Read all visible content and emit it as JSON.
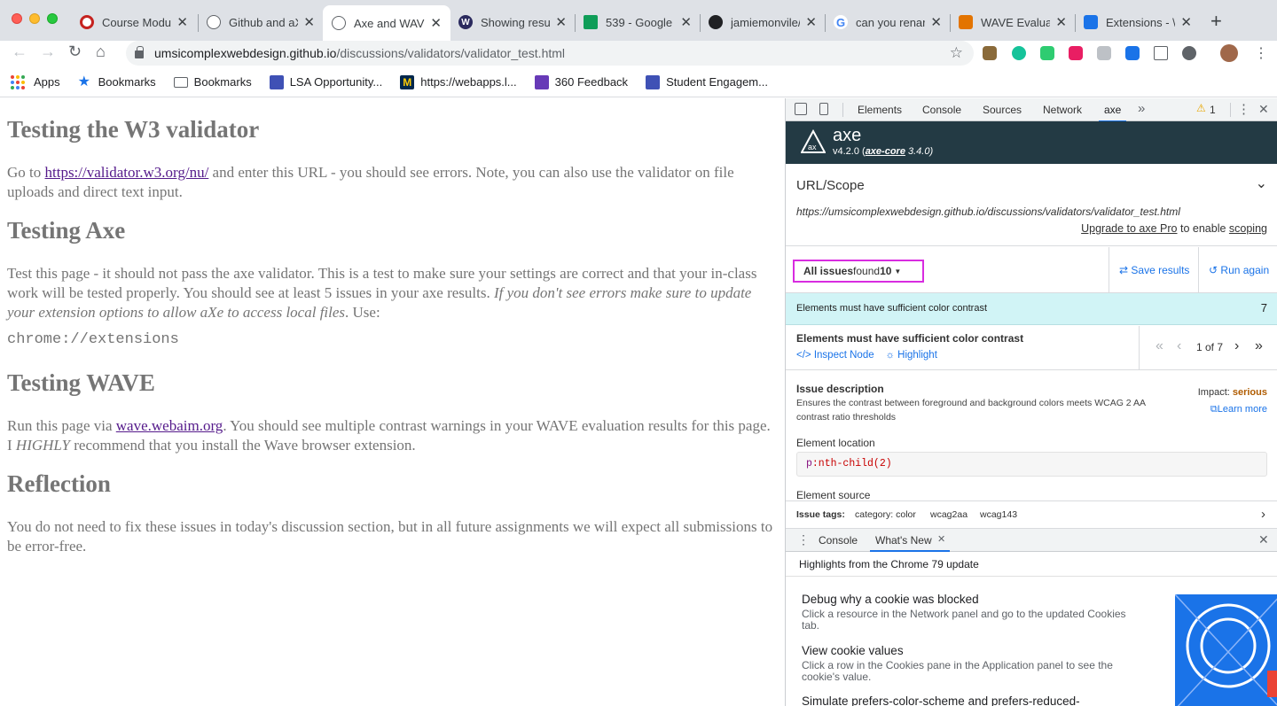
{
  "tabs": [
    {
      "title": "Course Modu",
      "favicon_color": "#c5221f",
      "favicon_symbol": "ring-icon"
    },
    {
      "title": "Github and aX",
      "favicon_color": "#5f6368",
      "favicon_symbol": "globe-icon"
    },
    {
      "title": "Axe and WAVE",
      "favicon_color": "#5f6368",
      "favicon_symbol": "globe-icon",
      "active": true
    },
    {
      "title": "Showing resu",
      "favicon_color": "#2b2a5e",
      "favicon_symbol": "wolverine-icon"
    },
    {
      "title": "539 - Google",
      "favicon_color": "#0f9d58",
      "favicon_symbol": "drive-icon"
    },
    {
      "title": "jamiemonvile/",
      "favicon_color": "#202124",
      "favicon_symbol": "github-icon"
    },
    {
      "title": "can you renar",
      "favicon_color": "#4285f4",
      "favicon_symbol": "google-icon"
    },
    {
      "title": "WAVE Evaluat",
      "favicon_color": "#e37400",
      "favicon_symbol": "wave-icon"
    },
    {
      "title": "Extensions - \\",
      "favicon_color": "#1a73e8",
      "favicon_symbol": "puzzle-icon"
    }
  ],
  "address": {
    "host": "umsicomplexwebdesign.github.io",
    "path": "/discussions/validators/validator_test.html"
  },
  "bookmarks": [
    {
      "label": "Apps",
      "icon": "apps-grid-icon"
    },
    {
      "label": "Bookmarks",
      "icon": "star-icon",
      "color": "#1a73e8"
    },
    {
      "label": "Bookmarks",
      "icon": "folder-icon",
      "color": "#5f6368"
    },
    {
      "label": "LSA Opportunity...",
      "icon": "lsa-icon",
      "color": "#3f51b5"
    },
    {
      "label": "https://webapps.l...",
      "icon": "block-m-icon",
      "color": "#00274c"
    },
    {
      "label": "360 Feedback",
      "icon": "form-icon",
      "color": "#673ab7"
    },
    {
      "label": "Student Engagem...",
      "icon": "calendar-icon",
      "color": "#3f51b5"
    }
  ],
  "page": {
    "h_w3": "Testing the W3 validator",
    "p_w3_pre": "Go to ",
    "p_w3_link": "https://validator.w3.org/nu/",
    "p_w3_post": " and enter this URL - you should see errors. Note, you can also use the validator on file uploads and direct text input.",
    "h_axe": "Testing Axe",
    "p_axe": "Test this page - it should not pass the axe validator. This is a test to make sure your settings are correct and that your in-class work will be tested properly. You should see at least 5 issues in your axe results. ",
    "p_axe_em": "If you don't see errors make sure to update your extension options to allow aXe to access local files",
    "p_axe_end": ". Use:",
    "code": "chrome://extensions",
    "h_wave": "Testing WAVE",
    "p_wave_pre": "Run this page via ",
    "p_wave_link": "wave.webaim.org",
    "p_wave_post": ". You should see multiple contrast warnings in your WAVE evaluation results for this page. I ",
    "p_wave_em": "HIGHLY",
    "p_wave_end": " recommend that you install the Wave browser extension.",
    "h_reflection": "Reflection",
    "p_reflection": "You do not need to fix these issues in today's discussion section, but in all future assignments we will expect all submissions to be error-free."
  },
  "devtools": {
    "tabs": [
      "Elements",
      "Console",
      "Sources",
      "Network",
      "axe"
    ],
    "active_tab": "axe",
    "warning_count": "1",
    "axe": {
      "name": "axe",
      "version": "v4.2.0 (",
      "core_label": "axe-core",
      "core_version": " 3.4.0)",
      "scope_title": "URL/Scope",
      "scope_url": "https://umsicomplexwebdesign.github.io/discussions/validators/validator_test.html",
      "upgrade_link": "Upgrade to axe Pro",
      "upgrade_mid": " to enable ",
      "upgrade_scoping": "scoping",
      "issues_prefix": "All issues",
      "issues_found": " found ",
      "issues_count": "10",
      "save_results": "Save results",
      "run_again": "Run again",
      "category_label": "Elements must have sufficient color contrast",
      "category_count": "7",
      "issue_title": "Elements must have sufficient color contrast",
      "inspect_node": "Inspect Node",
      "highlight": "Highlight",
      "pager": "1 of 7",
      "desc_title": "Issue description",
      "desc_text": "Ensures the contrast between foreground and background colors meets WCAG 2 AA contrast ratio thresholds",
      "impact_label": "Impact: ",
      "impact_value": "serious",
      "learn_more": "Learn more",
      "location_title": "Element location",
      "location_tag": "p",
      "location_selector": ":nth-child(2)",
      "source_title": "Element source",
      "tags_label": "Issue tags:",
      "tags": [
        "category: color",
        "wcag2aa",
        "wcag143"
      ],
      "accent": "#1a73e8",
      "highlight_border": "#d82ce0"
    },
    "drawer": {
      "tabs": [
        "Console",
        "What's New"
      ],
      "active_tab": "What's New",
      "header": "Highlights from the Chrome 79 update",
      "items": [
        {
          "title": "Debug why a cookie was blocked",
          "desc": "Click a resource in the Network panel and go to the updated Cookies tab."
        },
        {
          "title": "View cookie values",
          "desc": "Click a row in the Cookies pane in the Application panel to see the cookie's value."
        },
        {
          "title": "Simulate prefers-color-scheme and prefers-reduced-",
          "desc": ""
        }
      ]
    }
  }
}
